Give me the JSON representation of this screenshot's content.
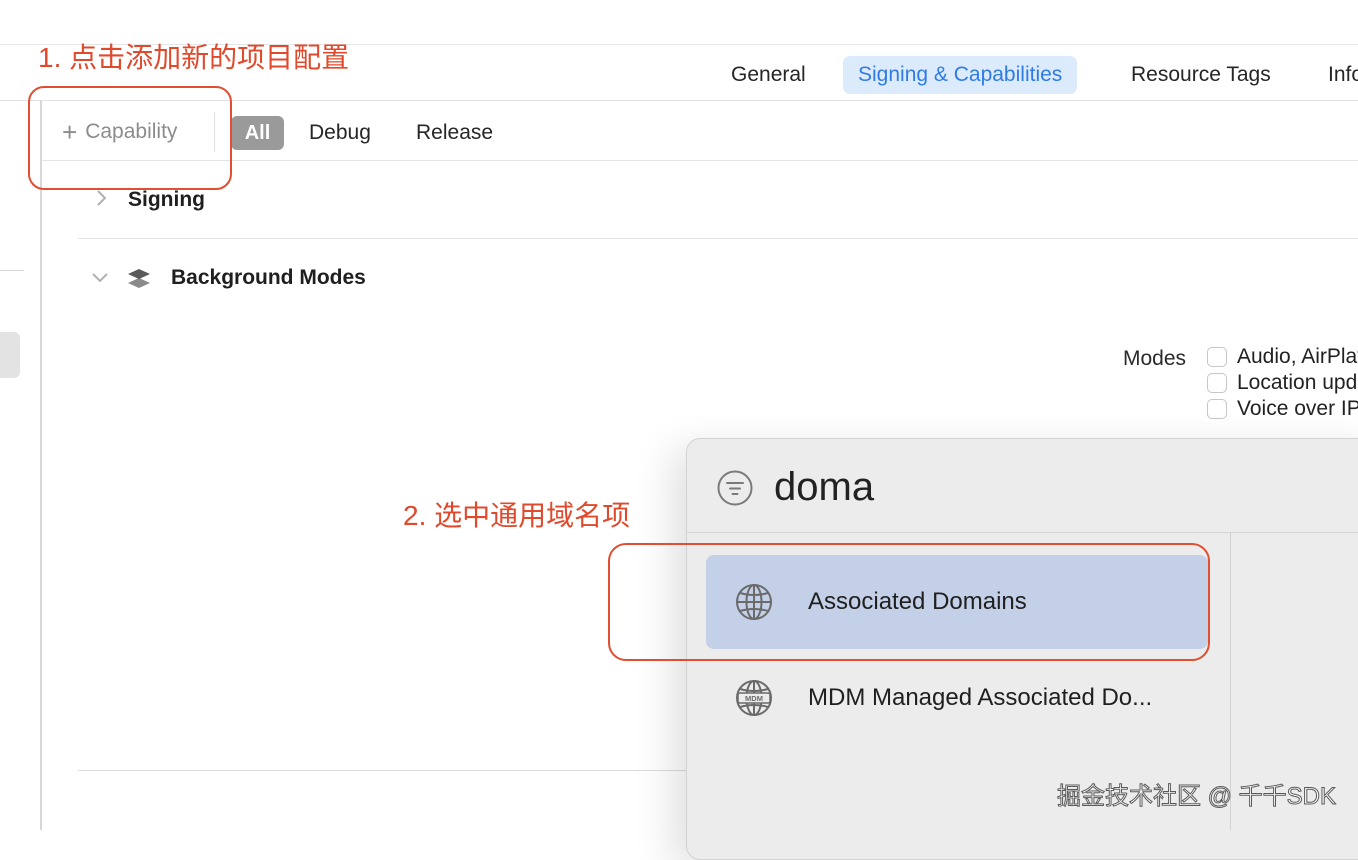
{
  "tabs": [
    {
      "label": "General",
      "selected": false
    },
    {
      "label": "Signing & Capabilities",
      "selected": true
    },
    {
      "label": "Resource Tags",
      "selected": false
    },
    {
      "label": "Info",
      "selected": false
    }
  ],
  "toolbar": {
    "add_capability_label": "Capability",
    "filters": [
      "All",
      "Debug",
      "Release"
    ]
  },
  "sections": {
    "signing": "Signing",
    "background_modes": "Background Modes"
  },
  "modes": {
    "label": "Modes",
    "options": [
      "Audio, AirPlay, and Picture in Picture",
      "Location updates",
      "Voice over IP"
    ]
  },
  "annotations": {
    "step1": "1. 点击添加新的项目配置",
    "step2": "2.  选中通用域名项"
  },
  "popup": {
    "search_value": "doma",
    "results": [
      "Associated Domains",
      "MDM Managed Associated Do..."
    ]
  },
  "watermark": "掘金技术社区 @ 千千SDK",
  "colors": {
    "accent": "#2f7be6",
    "selected_tab_bg": "#dcebfb",
    "annotation": "#e04f31",
    "selected_result_bg": "#c3d0e8"
  }
}
